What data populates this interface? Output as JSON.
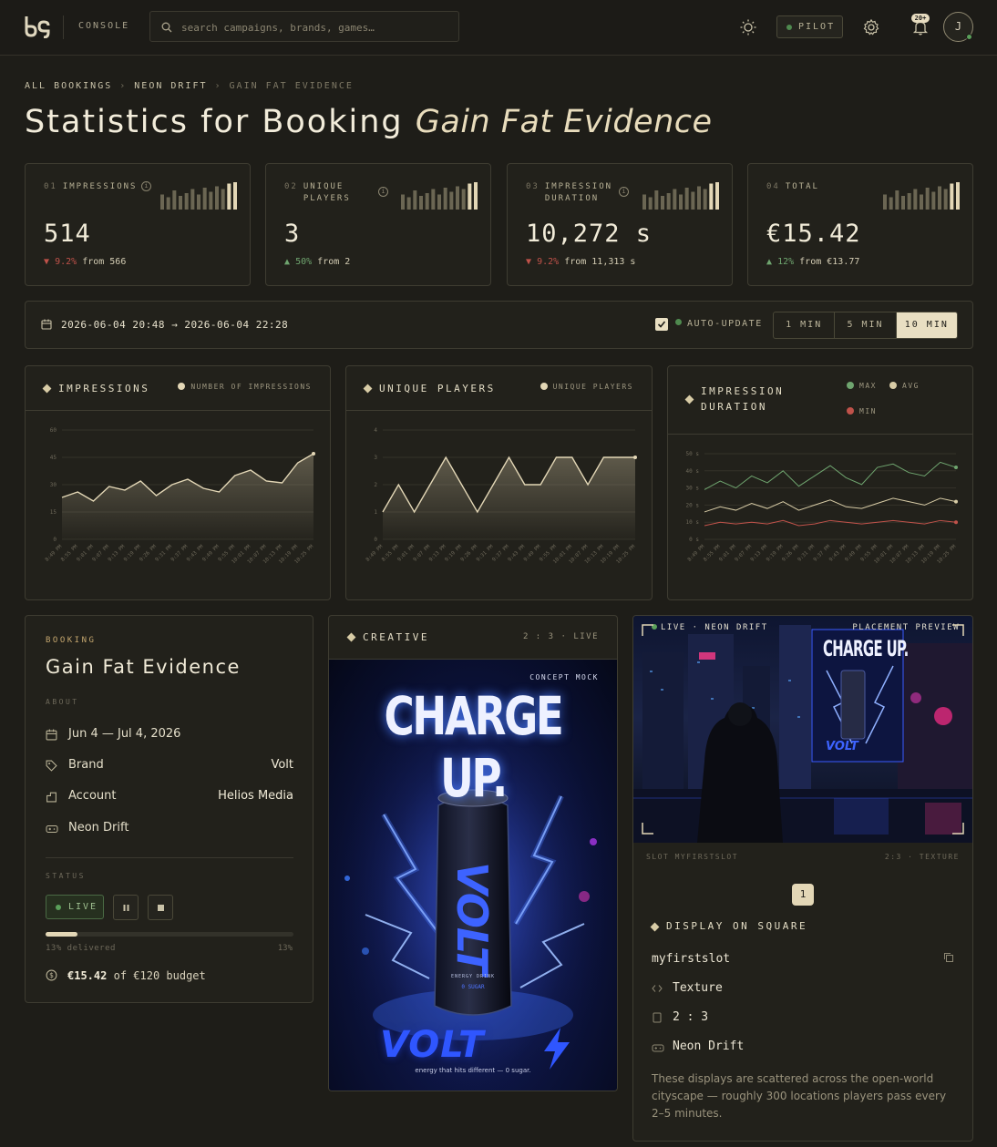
{
  "topbar": {
    "console_label": "CONSOLE",
    "search_placeholder": "search campaigns, brands, games…",
    "pilot_label": "PILOT",
    "notif_badge": "20+",
    "avatar_initial": "J"
  },
  "breadcrumb": {
    "items": [
      "ALL BOOKINGS",
      "NEON DRIFT",
      "GAIN FAT EVIDENCE"
    ],
    "separator": "›"
  },
  "page": {
    "title_prefix": "Statistics for Booking",
    "title_name": "Gain Fat Evidence"
  },
  "kpis": [
    {
      "num": "01",
      "label": "IMPRESSIONS",
      "value": "514",
      "change": "9.2%",
      "direction": "down",
      "from": "from 566",
      "spark": [
        0.55,
        0.45,
        0.7,
        0.5,
        0.6,
        0.75,
        0.55,
        0.8,
        0.65,
        0.85,
        0.75,
        0.95,
        1.0
      ]
    },
    {
      "num": "02",
      "label_l1": "UNIQUE",
      "label_l2": "PLAYERS",
      "value": "3",
      "change": "50%",
      "direction": "up",
      "from": "from 2",
      "spark": [
        0.55,
        0.45,
        0.7,
        0.5,
        0.6,
        0.75,
        0.55,
        0.8,
        0.65,
        0.85,
        0.75,
        0.95,
        1.0
      ]
    },
    {
      "num": "03",
      "label_l1": "IMPRESSION",
      "label_l2": "DURATION",
      "value": "10,272 s",
      "change": "9.2%",
      "direction": "down",
      "from": "from 11,313 s",
      "spark": [
        0.55,
        0.45,
        0.7,
        0.5,
        0.6,
        0.75,
        0.55,
        0.8,
        0.65,
        0.85,
        0.75,
        0.95,
        1.0
      ]
    },
    {
      "num": "04",
      "label": "TOTAL",
      "value": "€15.42",
      "change": "12%",
      "direction": "up",
      "from": "from €13.77",
      "spark": [
        0.55,
        0.45,
        0.7,
        0.5,
        0.6,
        0.75,
        0.55,
        0.8,
        0.65,
        0.85,
        0.75,
        0.95,
        1.0
      ]
    }
  ],
  "daterange": {
    "start": "2026-06-04 20:48",
    "arrow": "→",
    "end": "2026-06-04 22:28",
    "auto_update_label": "AUTO-UPDATE",
    "auto_update_checked": true,
    "intervals": [
      "1 MIN",
      "5 MIN",
      "10 MIN"
    ],
    "selected_interval": "10 MIN"
  },
  "chart_data": [
    {
      "type": "area",
      "title": "IMPRESSIONS",
      "legend": [
        "NUMBER OF IMPRESSIONS"
      ],
      "x": [
        "8:49 PM",
        "8:55 PM",
        "9:01 PM",
        "9:07 PM",
        "9:13 PM",
        "9:19 PM",
        "9:26 PM",
        "9:31 PM",
        "9:37 PM",
        "9:43 PM",
        "9:49 PM",
        "9:55 PM",
        "10:01 PM",
        "10:07 PM",
        "10:13 PM",
        "10:19 PM",
        "10:25 PM"
      ],
      "series": [
        {
          "name": "NUMBER OF IMPRESSIONS",
          "values": [
            23,
            26,
            21,
            29,
            27,
            32,
            24,
            30,
            33,
            28,
            26,
            35,
            38,
            32,
            31,
            42,
            47
          ]
        }
      ],
      "yticks": [
        0,
        15,
        30,
        45,
        60
      ],
      "ylim": [
        0,
        60
      ]
    },
    {
      "type": "area",
      "title": "UNIQUE PLAYERS",
      "legend": [
        "UNIQUE PLAYERS"
      ],
      "x": [
        "8:49 PM",
        "8:55 PM",
        "9:01 PM",
        "9:07 PM",
        "9:13 PM",
        "9:19 PM",
        "9:26 PM",
        "9:31 PM",
        "9:37 PM",
        "9:43 PM",
        "9:49 PM",
        "9:55 PM",
        "10:01 PM",
        "10:07 PM",
        "10:13 PM",
        "10:19 PM",
        "10:25 PM"
      ],
      "series": [
        {
          "name": "UNIQUE PLAYERS",
          "values": [
            1,
            2,
            1,
            2,
            3,
            2,
            1,
            2,
            3,
            2,
            2,
            3,
            3,
            2,
            3,
            3,
            3
          ]
        }
      ],
      "yticks": [
        0,
        1,
        2,
        3,
        4
      ],
      "ylim": [
        0,
        4
      ]
    },
    {
      "type": "line",
      "title": "IMPRESSION DURATION",
      "legend": [
        "MAX",
        "AVG",
        "MIN"
      ],
      "x": [
        "8:49 PM",
        "8:55 PM",
        "9:01 PM",
        "9:07 PM",
        "9:13 PM",
        "9:19 PM",
        "9:26 PM",
        "9:31 PM",
        "9:37 PM",
        "9:43 PM",
        "9:49 PM",
        "9:55 PM",
        "10:01 PM",
        "10:07 PM",
        "10:13 PM",
        "10:19 PM",
        "10:25 PM"
      ],
      "series": [
        {
          "name": "MAX",
          "values": [
            29,
            34,
            30,
            37,
            33,
            40,
            31,
            37,
            43,
            36,
            32,
            42,
            44,
            39,
            37,
            45,
            42
          ]
        },
        {
          "name": "AVG",
          "values": [
            16,
            19,
            17,
            21,
            18,
            22,
            17,
            20,
            23,
            19,
            18,
            21,
            24,
            22,
            20,
            24,
            22
          ]
        },
        {
          "name": "MIN",
          "values": [
            8,
            10,
            9,
            10,
            9,
            11,
            8,
            9,
            11,
            10,
            9,
            10,
            11,
            10,
            9,
            11,
            10
          ]
        }
      ],
      "yticks": [
        0,
        10,
        20,
        30,
        40,
        50
      ],
      "ytick_unit": "s",
      "ylim": [
        0,
        50
      ]
    }
  ],
  "booking": {
    "kicker": "BOOKING",
    "title": "Gain Fat Evidence",
    "about": "ABOUT",
    "dates": "Jun 4 — Jul 4, 2026",
    "brand_label": "Brand",
    "brand_value": "Volt",
    "account_label": "Account",
    "account_value": "Helios Media",
    "game": "Neon Drift",
    "status_label": "STATUS",
    "status_value": "LIVE",
    "progress": 0.13,
    "delivered": "13% delivered",
    "delivered_pct": "13%",
    "spend": "€15.42",
    "budget": "of €120 budget"
  },
  "creative": {
    "title": "CREATIVE",
    "meta": "2 : 3 · LIVE",
    "concept": "CONCEPT MOCK",
    "headline": "CHARGE UP.",
    "can_text": "VOLT",
    "can_sub": "ENERGY DRINK",
    "can_sub2": "0 SUGAR",
    "brand_logo": "VOLT",
    "tagline": "energy that hits different — 0 sugar."
  },
  "placement": {
    "live_tag": "LIVE · NEON DRIFT",
    "preview_tag": "PLACEMENT PREVIEW",
    "billboard_headline": "CHARGE UP.",
    "billboard_logo": "VOLT",
    "slot_label": "SLOT MYFIRSTSLOT",
    "slot_meta": "2:3 · TEXTURE",
    "step": "1",
    "display_title": "DISPLAY ON SQUARE",
    "slot_name": "myfirstslot",
    "type": "Texture",
    "ratio": "2 : 3",
    "game": "Neon Drift",
    "description": "These displays are scattered across the open-world cityscape — roughly 300 locations players pass every 2–5 minutes."
  },
  "colors": {
    "accent": "#e9dfc2",
    "up": "#6fa56f",
    "down": "#c0524a",
    "live": "#5aa05a",
    "max_series": "#6fa56f",
    "avg_series": "#d8cca6",
    "min_series": "#c0524a"
  }
}
